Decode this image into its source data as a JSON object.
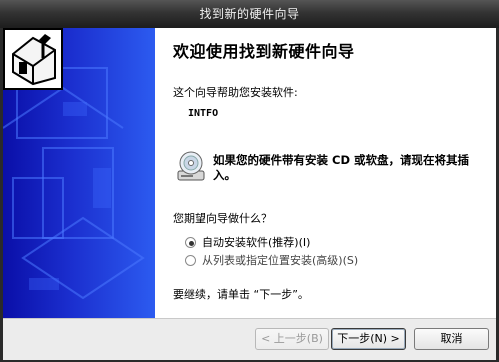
{
  "window": {
    "title": "找到新的硬件向导"
  },
  "banner": {
    "icon": "hardware-installer-icon",
    "background_color": "#1b2fcf"
  },
  "main": {
    "heading": "欢迎使用找到新硬件向导",
    "intro": "这个向导帮助您安装软件:",
    "device_name": "INTFO",
    "cd_prompt": "如果您的硬件带有安装 CD 或软盘，请现在将其插入。",
    "question": "您期望向导做什么？",
    "options": [
      {
        "label": "自动安装软件(推荐)(I)",
        "selected": true
      },
      {
        "label": "从列表或指定位置安装(高级)(S)",
        "selected": false
      }
    ],
    "continue_hint": "要继续，请单击 “下一步”。"
  },
  "buttons": {
    "back": "< 上一步(B)",
    "next": "下一步(N) >",
    "cancel": "取消"
  }
}
